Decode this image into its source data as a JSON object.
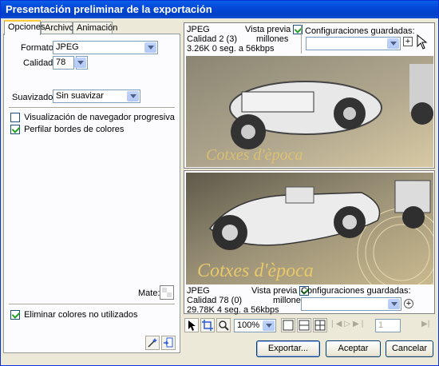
{
  "window": {
    "title": "Presentación preliminar de la exportación"
  },
  "tabs": [
    "Opciones",
    "Archivo",
    "Animación"
  ],
  "options": {
    "format_label": "Formato:",
    "format_value": "JPEG",
    "quality_label": "Calidad:",
    "quality_value": "78",
    "smoothing_label": "Suavizado:",
    "smoothing_value": "Sin suavizar",
    "progressive_label": "Visualización de navegador progresiva",
    "progressive_checked": false,
    "sharpen_label": "Perfilar bordes de colores",
    "sharpen_checked": true,
    "matte_label": "Mate:",
    "remove_unused_label": "Eliminar colores no utilizados",
    "remove_unused_checked": true
  },
  "preview_top": {
    "format": "JPEG",
    "quality": "Calidad 2 (3)",
    "size": "3.26K  0 seg. a 56kbps",
    "preview_label": "Vista previa",
    "colors": "millones",
    "saved_label": "Configuraciones guardadas:",
    "caption": "Cotxes d'època"
  },
  "preview_bottom": {
    "format": "JPEG",
    "quality": "Calidad 78 (0)",
    "size": "29.78K  4 seg. a 56kbps",
    "preview_label": "Vista previa",
    "colors": "millones",
    "saved_label": "Configuraciones guardadas:",
    "caption": "Cotxes d'època"
  },
  "toolbar": {
    "zoom": "100%",
    "frame": "1"
  },
  "buttons": {
    "export": "Exportar...",
    "ok": "Aceptar",
    "cancel": "Cancelar"
  },
  "colors": {
    "title_bar": "#0447d6",
    "dialog_bg": "#ece9d8",
    "caption_gold": "#e8c86a"
  }
}
